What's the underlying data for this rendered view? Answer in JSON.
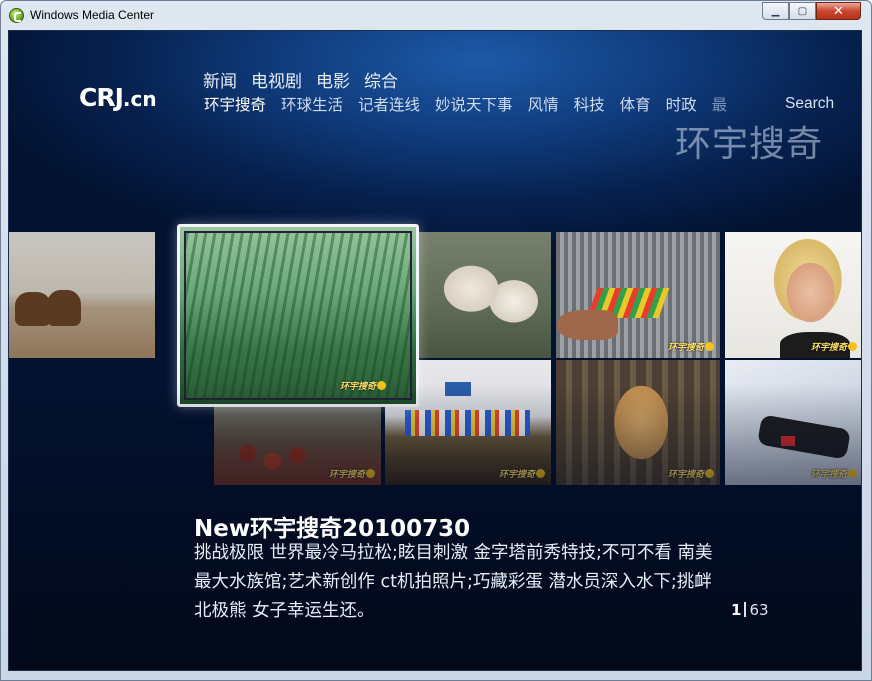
{
  "window": {
    "title": "Windows Media Center"
  },
  "brand": {
    "logo_text": "CRJ",
    "logo_suffix": ".cn"
  },
  "nav": {
    "top": [
      "新闻",
      "电视剧",
      "电影",
      "综合"
    ],
    "sub": [
      "环宇搜奇",
      "环球生活",
      "记者连线",
      "妙说天下事",
      "风情",
      "科技",
      "体育",
      "时政",
      "最"
    ],
    "active_sub": "环宇搜奇",
    "search_label": "Search"
  },
  "section_title": "环宇搜奇",
  "thumb_watermark": "环宇搜奇",
  "selected": {
    "title": "New环宇搜奇20100730",
    "description": "挑战极限 世界最冷马拉松;眩目刺激 金字塔前秀特技;不可不看 南美最大水族馆;艺术新创作 ct机拍照片;巧藏彩蛋 潜水员深入水下;挑衅北极熊 女子幸运生还。"
  },
  "pager": {
    "current": "1",
    "total": "63"
  }
}
